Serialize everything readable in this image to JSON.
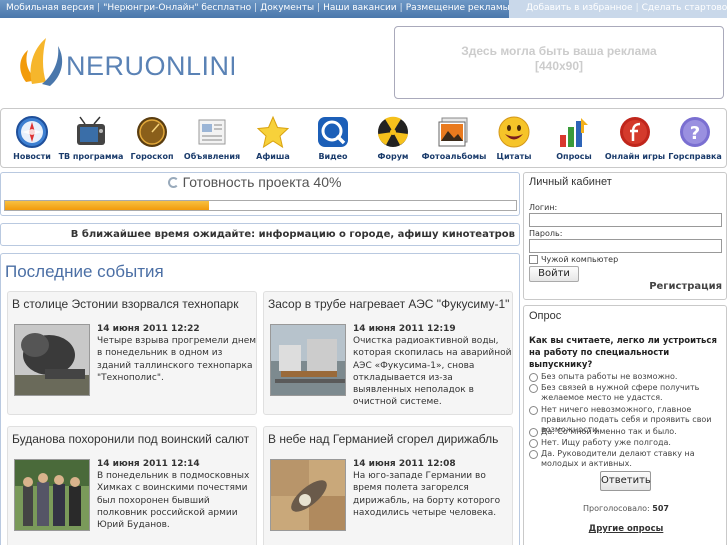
{
  "topbar": {
    "links": [
      "Мобильная версия",
      "\"Нерюнгри-Онлайн\" бесплатно",
      "Документы",
      "Наши вакансии",
      "Размещение рекламы"
    ],
    "separator": "|",
    "right_links": [
      "Добавить в избранное",
      "Сделать стартовой"
    ]
  },
  "logo": {
    "brand": "NERUONLINE"
  },
  "ad": {
    "line1": "Здесь могла быть ваша реклама",
    "line2": "[440x90]"
  },
  "nav": [
    {
      "label": "Новости",
      "icon": "compass-icon"
    },
    {
      "label": "ТВ программа",
      "icon": "tv-icon"
    },
    {
      "label": "Гороскоп",
      "icon": "horoscope-icon"
    },
    {
      "label": "Объявления",
      "icon": "ads-icon"
    },
    {
      "label": "Афиша",
      "icon": "star-icon"
    },
    {
      "label": "Видео",
      "icon": "video-icon"
    },
    {
      "label": "Форум",
      "icon": "forum-icon"
    },
    {
      "label": "Фотоальбомы",
      "icon": "photo-icon"
    },
    {
      "label": "Цитаты",
      "icon": "smile-icon"
    },
    {
      "label": "Опросы",
      "icon": "chart-icon"
    },
    {
      "label": "Онлайн игры",
      "icon": "games-icon"
    },
    {
      "label": "Горсправка",
      "icon": "help-icon"
    }
  ],
  "progress": {
    "text": "Готовность проекта 40%",
    "value": 0.4
  },
  "notice": "В ближайшее время ожидайте: информацию о городе, афишу кинотеатров",
  "news": {
    "title": "Последние события",
    "items": [
      {
        "title": "В столице Эстонии взорвался технопарк",
        "date": "14 июня 2011 12:22",
        "text": "Четыре взрыва прогремели днем в понедельник в одном из зданий таллинского технопарка \"Технополис\"."
      },
      {
        "title": "Засор в трубе нагревает АЭС \"Фукусиму-1\"",
        "date": "14 июня 2011 12:19",
        "text": "Очистка радиоактивной воды, которая скопилась на аварийной АЭС «Фукусима-1», снова откладывается из-за выявленных неполадок в очистной системе."
      },
      {
        "title": "Буданова похоронили под воинский салют",
        "date": "14 июня 2011 12:14",
        "text": "В понедельник в подмосковных Химках с воинскими почестями был похоронен бывший полковник российской армии Юрий Буданов."
      },
      {
        "title": "В небе над Германией сгорел дирижабль",
        "date": "14 июня 2011 12:08",
        "text": "На юго-западе Германии во время полета загорелся дирижабль, на борту которого находились четыре человека."
      }
    ]
  },
  "cabinet": {
    "title": "Личный кабинет",
    "login_label": "Логин:",
    "password_label": "Пароль:",
    "remember_label": "Чужой компьютер",
    "login_button": "Войти",
    "register_link": "Регистрация"
  },
  "poll": {
    "title": "Опрос",
    "question": "Как вы считаете, легко ли устроиться на работу по специальности выпускнику?",
    "options": [
      "Без опыта работы не возможно.",
      "Без связей в нужной сфере получить желаемое место не удастся.",
      "Нет ничего невозможного, главное правильно подать себя и проявить свои возможности.",
      "Да. Со мной именно так и было.",
      "Нет. Ищу работу уже полгода.",
      "Да. Руководители делают ставку на молодых и активных."
    ],
    "vote_button": "Ответить",
    "voted_label": "Проголосовало:",
    "voted_count": "507",
    "other_link": "Другие опросы"
  }
}
